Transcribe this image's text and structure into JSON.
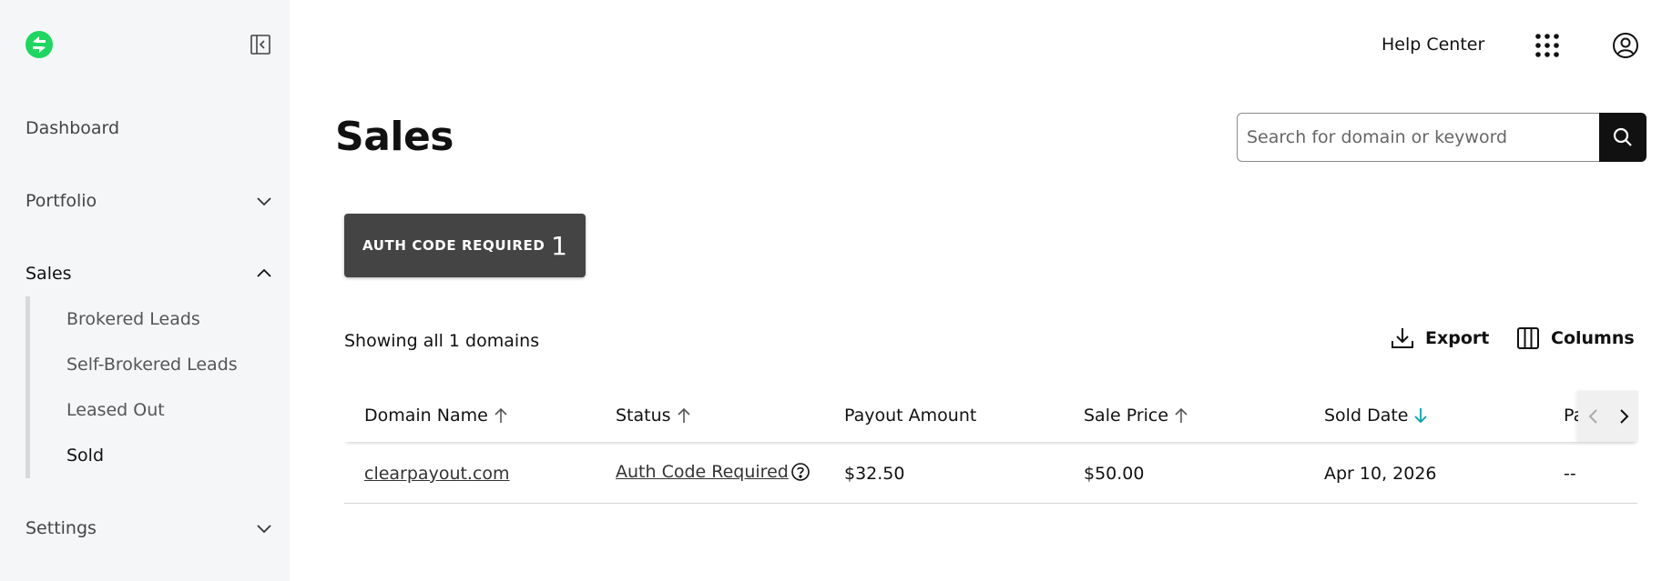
{
  "sidebar": {
    "items": [
      {
        "label": "Dashboard"
      },
      {
        "label": "Portfolio"
      },
      {
        "label": "Sales"
      },
      {
        "label": "Settings"
      }
    ],
    "sales_subitems": [
      {
        "label": "Brokered Leads"
      },
      {
        "label": "Self-Brokered Leads"
      },
      {
        "label": "Leased Out"
      },
      {
        "label": "Sold"
      }
    ]
  },
  "header": {
    "help_center": "Help Center"
  },
  "main": {
    "title": "Sales",
    "search": {
      "placeholder": "Search for domain or keyword",
      "value": ""
    },
    "filter_chip": {
      "label": "AUTH CODE REQUIRED",
      "count": "1"
    },
    "showing": "Showing all 1 domains",
    "export_label": "Export",
    "columns_label": "Columns"
  },
  "table": {
    "headers": [
      "Domain Name",
      "Status",
      "Payout Amount",
      "Sale Price",
      "Sold Date",
      "Pa"
    ],
    "rows": [
      {
        "domain": "clearpayout.com",
        "status": "Auth Code Required",
        "payout": "$32.50",
        "sale_price": "$50.00",
        "sold_date": "Apr 10, 2026",
        "payment": "--"
      }
    ]
  },
  "colors": {
    "brand_green": "#1ed760",
    "accent_teal": "#00a4a6",
    "chip_bg": "#444444"
  },
  "icons": [
    "logo-icon",
    "collapse-sidebar-icon",
    "chevron-down-icon",
    "chevron-up-icon",
    "apps-grid-icon",
    "account-icon",
    "search-icon",
    "download-icon",
    "columns-icon",
    "arrow-up-icon",
    "arrow-down-icon",
    "help-circle-icon",
    "chevron-left-icon",
    "chevron-right-icon"
  ]
}
